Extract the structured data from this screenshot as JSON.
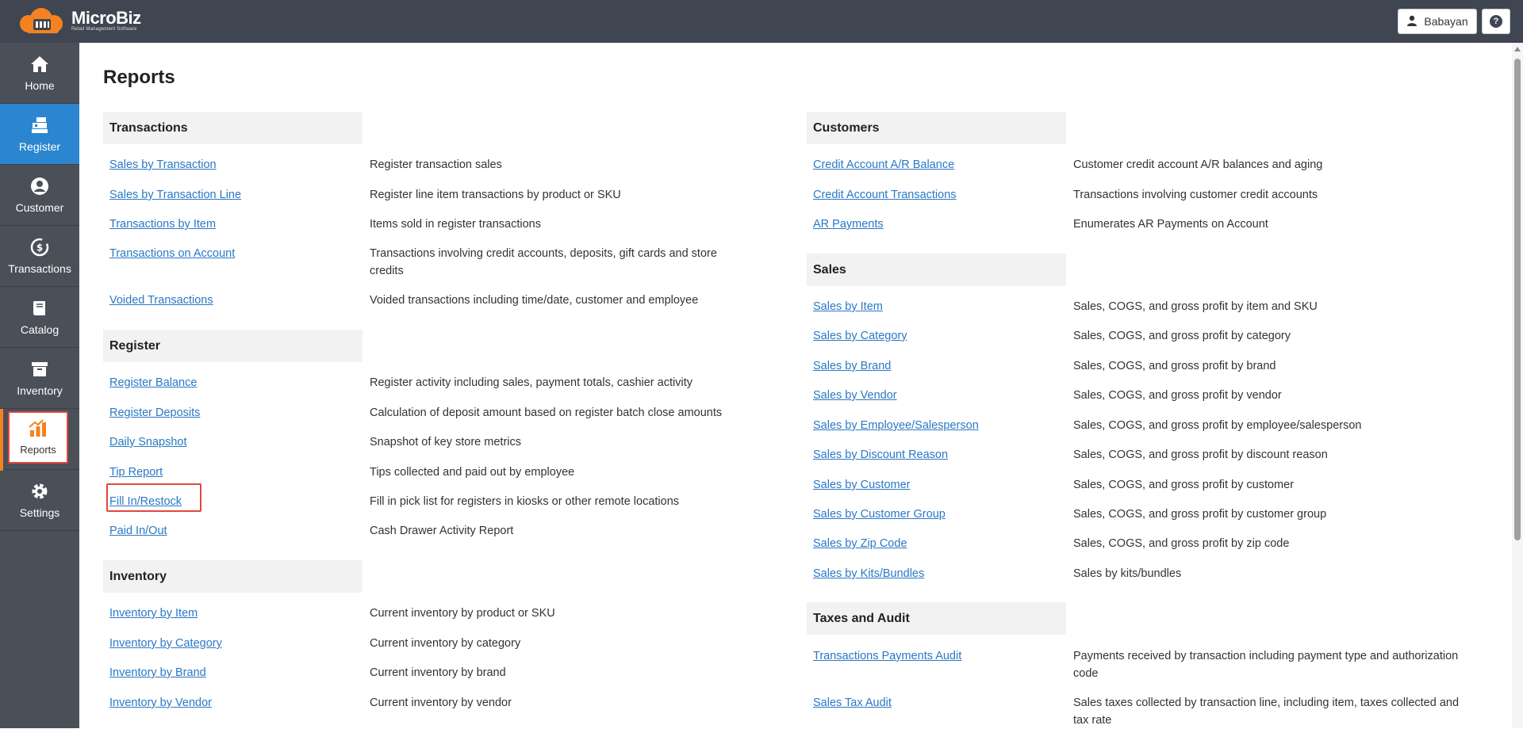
{
  "app": {
    "name": "MicroBiz",
    "tagline": "Retail Management Software"
  },
  "header": {
    "user_name": "Babayan",
    "help_label": "?"
  },
  "sidebar": {
    "items": [
      {
        "label": "Home",
        "icon": "home-icon"
      },
      {
        "label": "Register",
        "icon": "register-icon"
      },
      {
        "label": "Customer",
        "icon": "customer-icon"
      },
      {
        "label": "Transactions",
        "icon": "transactions-icon"
      },
      {
        "label": "Catalog",
        "icon": "catalog-icon"
      },
      {
        "label": "Inventory",
        "icon": "inventory-icon"
      },
      {
        "label": "Reports",
        "icon": "reports-icon"
      },
      {
        "label": "Settings",
        "icon": "settings-icon"
      }
    ]
  },
  "page": {
    "title": "Reports"
  },
  "sections": {
    "transactions": {
      "title": "Transactions",
      "rows": [
        {
          "link": "Sales by Transaction",
          "desc": "Register transaction sales"
        },
        {
          "link": "Sales by Transaction Line",
          "desc": "Register line item transactions by product or SKU"
        },
        {
          "link": "Transactions by Item",
          "desc": "Items sold in register transactions"
        },
        {
          "link": "Transactions on Account",
          "desc": "Transactions involving credit accounts, deposits, gift cards and store credits"
        },
        {
          "link": "Voided Transactions",
          "desc": "Voided transactions including time/date, customer and employee"
        }
      ]
    },
    "register": {
      "title": "Register",
      "rows": [
        {
          "link": "Register Balance",
          "desc": "Register activity including sales, payment totals, cashier activity"
        },
        {
          "link": "Register Deposits",
          "desc": "Calculation of deposit amount based on register batch close amounts"
        },
        {
          "link": "Daily Snapshot",
          "desc": "Snapshot of key store metrics"
        },
        {
          "link": "Tip Report",
          "desc": "Tips collected and paid out by employee"
        },
        {
          "link": "Fill In/Restock",
          "desc": "Fill in pick list for registers in kiosks or other remote locations"
        },
        {
          "link": "Paid In/Out",
          "desc": "Cash Drawer Activity Report"
        }
      ]
    },
    "inventory": {
      "title": "Inventory",
      "rows": [
        {
          "link": "Inventory by Item",
          "desc": "Current inventory by product or SKU"
        },
        {
          "link": "Inventory by Category",
          "desc": "Current inventory by category"
        },
        {
          "link": "Inventory by Brand",
          "desc": "Current inventory by brand"
        },
        {
          "link": "Inventory by Vendor",
          "desc": "Current inventory by vendor"
        }
      ]
    },
    "customers": {
      "title": "Customers",
      "rows": [
        {
          "link": "Credit Account A/R Balance",
          "desc": "Customer credit account A/R balances and aging"
        },
        {
          "link": "Credit Account Transactions",
          "desc": "Transactions involving customer credit accounts"
        },
        {
          "link": "AR Payments",
          "desc": "Enumerates AR Payments on Account"
        }
      ]
    },
    "sales": {
      "title": "Sales",
      "rows": [
        {
          "link": "Sales by Item",
          "desc": "Sales, COGS, and gross profit by item and SKU"
        },
        {
          "link": "Sales by Category",
          "desc": "Sales, COGS, and gross profit by category"
        },
        {
          "link": "Sales by Brand",
          "desc": "Sales, COGS, and gross profit by brand"
        },
        {
          "link": "Sales by Vendor",
          "desc": "Sales, COGS, and gross profit by vendor"
        },
        {
          "link": "Sales by Employee/Salesperson",
          "desc": "Sales, COGS, and gross profit by employee/salesperson"
        },
        {
          "link": "Sales by Discount Reason",
          "desc": "Sales, COGS, and gross profit by discount reason"
        },
        {
          "link": "Sales by Customer",
          "desc": "Sales, COGS, and gross profit by customer"
        },
        {
          "link": "Sales by Customer Group",
          "desc": "Sales, COGS, and gross profit by customer group"
        },
        {
          "link": "Sales by Zip Code",
          "desc": "Sales, COGS, and gross profit by zip code"
        },
        {
          "link": "Sales by Kits/Bundles",
          "desc": "Sales by kits/bundles"
        }
      ]
    },
    "taxes": {
      "title": "Taxes and Audit",
      "rows": [
        {
          "link": "Transactions Payments Audit",
          "desc": "Payments received by transaction including payment type and authorization code"
        },
        {
          "link": "Sales Tax Audit",
          "desc": "Sales taxes collected by transaction line, including item, taxes collected and tax rate"
        }
      ]
    }
  },
  "colors": {
    "accent": "#2b86cf",
    "highlight": "#e2473b",
    "brand_orange": "#f58220",
    "link": "#2a78c5"
  }
}
